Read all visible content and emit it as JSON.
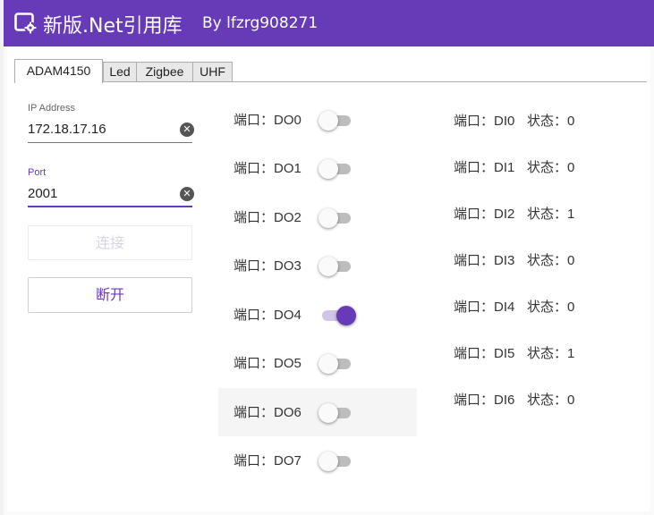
{
  "window": {
    "title": "新版.Net引用库",
    "author": "By lfzrg908271",
    "app_icon": "settings-window-icon"
  },
  "tabs": [
    {
      "label": "ADAM4150",
      "active": true
    },
    {
      "label": "Led",
      "active": false
    },
    {
      "label": "Zigbee",
      "active": false
    },
    {
      "label": "UHF",
      "active": false
    }
  ],
  "connection": {
    "ip_label": "IP Address",
    "ip_value": "172.18.17.16",
    "port_label": "Port",
    "port_value": "2001",
    "connect_label": "连接",
    "connect_enabled": false,
    "disconnect_label": "断开",
    "clear_icon": "clear-circle-icon"
  },
  "outputs": [
    {
      "prefix": "端口：",
      "name": "DO0",
      "on": false
    },
    {
      "prefix": "端口：",
      "name": "DO1",
      "on": false
    },
    {
      "prefix": "端口：",
      "name": "DO2",
      "on": false
    },
    {
      "prefix": "端口：",
      "name": "DO3",
      "on": false
    },
    {
      "prefix": "端口：",
      "name": "DO4",
      "on": true
    },
    {
      "prefix": "端口：",
      "name": "DO5",
      "on": false
    },
    {
      "prefix": "端口：",
      "name": "DO6",
      "on": false
    },
    {
      "prefix": "端口：",
      "name": "DO7",
      "on": false
    }
  ],
  "inputs": [
    {
      "prefix": "端口：",
      "name": "DI0",
      "state_label": "状态：",
      "state": "0"
    },
    {
      "prefix": "端口：",
      "name": "DI1",
      "state_label": "状态：",
      "state": "0"
    },
    {
      "prefix": "端口：",
      "name": "DI2",
      "state_label": "状态：",
      "state": "1"
    },
    {
      "prefix": "端口：",
      "name": "DI3",
      "state_label": "状态：",
      "state": "0"
    },
    {
      "prefix": "端口：",
      "name": "DI4",
      "state_label": "状态：",
      "state": "0"
    },
    {
      "prefix": "端口：",
      "name": "DI5",
      "state_label": "状态：",
      "state": "1"
    },
    {
      "prefix": "端口：",
      "name": "DI6",
      "state_label": "状态：",
      "state": "0"
    }
  ],
  "colors": {
    "accent": "#673ab7",
    "accent_light": "#d1c4e9",
    "toggle_off_track": "#bdbdbd"
  }
}
